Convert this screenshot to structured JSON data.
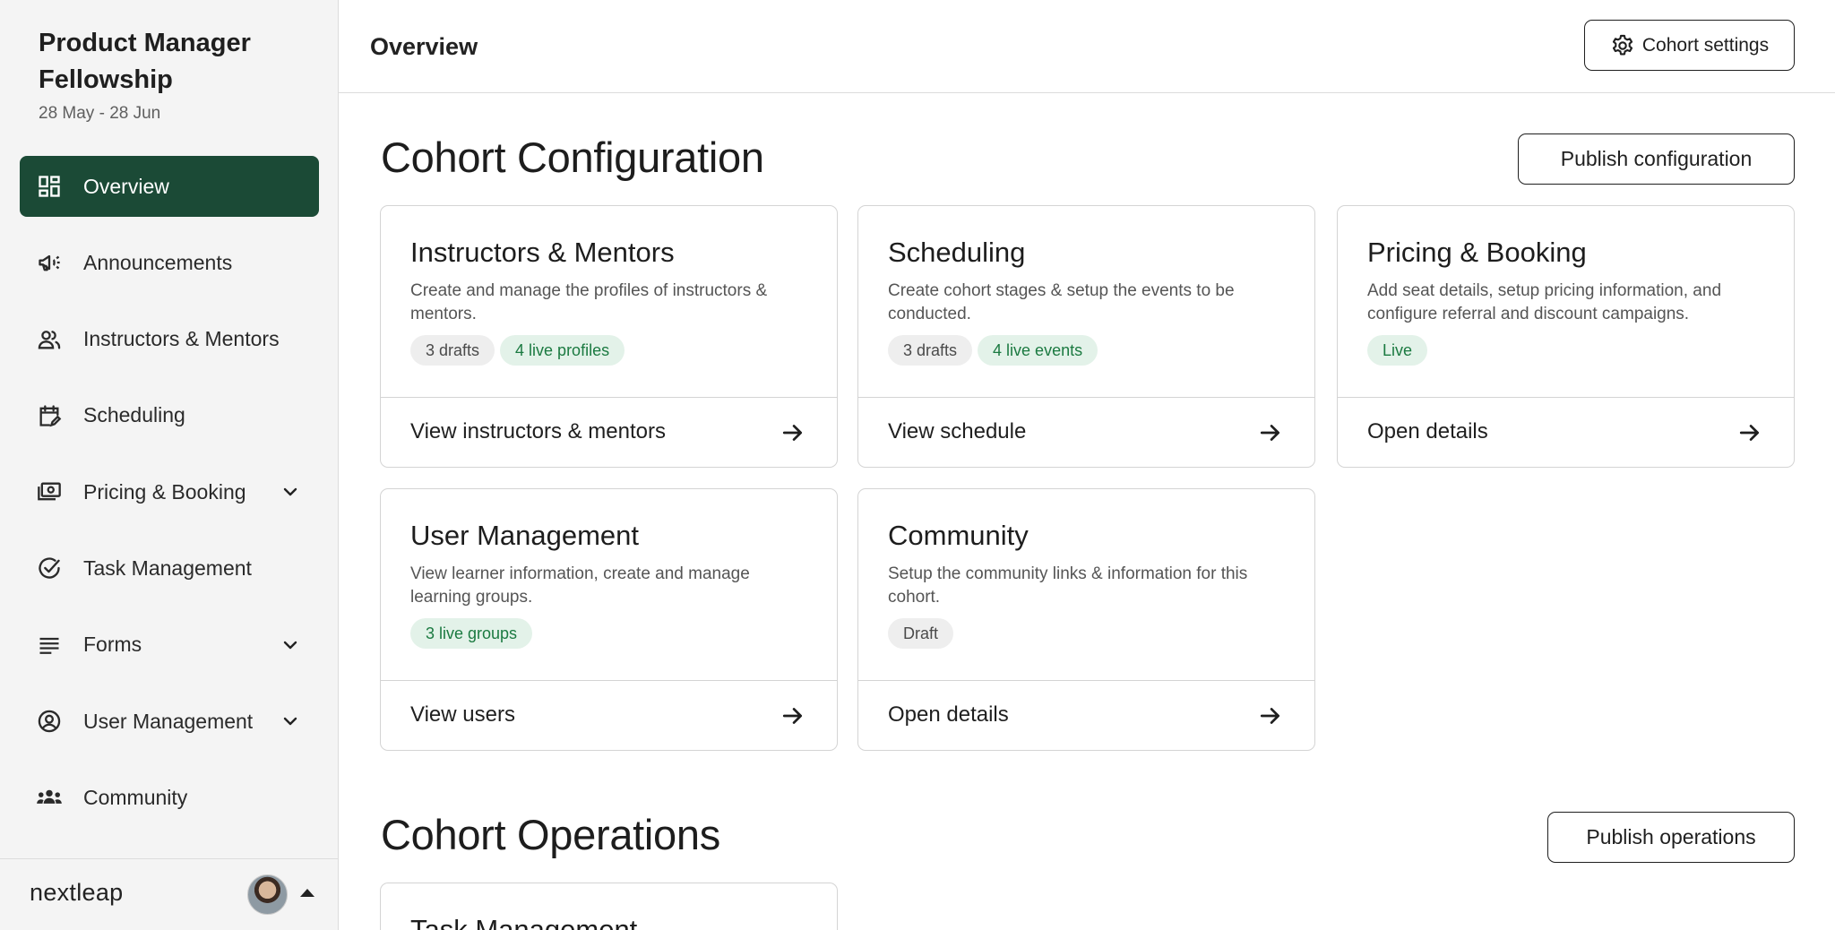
{
  "sidebar": {
    "title": "Product Manager Fellowship",
    "dates": "28 May - 28 Jun",
    "items": [
      {
        "label": "Overview",
        "icon": "dashboard-icon",
        "active": true
      },
      {
        "label": "Announcements",
        "icon": "megaphone-icon"
      },
      {
        "label": "Instructors & Mentors",
        "icon": "users-icon"
      },
      {
        "label": "Scheduling",
        "icon": "calendar-edit-icon"
      },
      {
        "label": "Pricing & Booking",
        "icon": "money-icon",
        "expandable": true
      },
      {
        "label": "Task Management",
        "icon": "check-circle-icon"
      },
      {
        "label": "Forms",
        "icon": "lines-icon",
        "expandable": true
      },
      {
        "label": "User Management",
        "icon": "user-circle-icon",
        "expandable": true
      },
      {
        "label": "Community",
        "icon": "group-icon"
      }
    ],
    "footer": {
      "logo": "nextleap"
    }
  },
  "header": {
    "title": "Overview",
    "settings_label": "Cohort settings"
  },
  "configuration": {
    "title": "Cohort Configuration",
    "publish_label": "Publish configuration",
    "cards": [
      {
        "title": "Instructors & Mentors",
        "desc": "Create and manage the profiles of instructors & mentors.",
        "tags": [
          {
            "text": "3 drafts",
            "tone": "gray"
          },
          {
            "text": "4 live profiles",
            "tone": "green"
          }
        ],
        "link": "View instructors & mentors"
      },
      {
        "title": "Scheduling",
        "desc": "Create cohort stages & setup the events to be conducted.",
        "tags": [
          {
            "text": "3 drafts",
            "tone": "gray"
          },
          {
            "text": "4 live events",
            "tone": "green"
          }
        ],
        "link": "View schedule"
      },
      {
        "title": "Pricing & Booking",
        "desc": "Add seat details, setup pricing information, and configure referral and discount campaigns.",
        "tags": [
          {
            "text": "Live",
            "tone": "green"
          }
        ],
        "link": "Open details"
      },
      {
        "title": "User Management",
        "desc": "View learner information, create and manage learning groups.",
        "tags": [
          {
            "text": "3 live groups",
            "tone": "green"
          }
        ],
        "link": "View users"
      },
      {
        "title": "Community",
        "desc": "Setup the community links & information for this cohort.",
        "tags": [
          {
            "text": "Draft",
            "tone": "gray"
          }
        ],
        "link": "Open details"
      }
    ]
  },
  "operations": {
    "title": "Cohort Operations",
    "publish_label": "Publish operations",
    "cards": [
      {
        "title": "Task Management"
      }
    ]
  },
  "colors": {
    "accent": "#1b4a36",
    "live_tag_bg": "#e3f2e9",
    "live_tag_text": "#1b7a41"
  }
}
